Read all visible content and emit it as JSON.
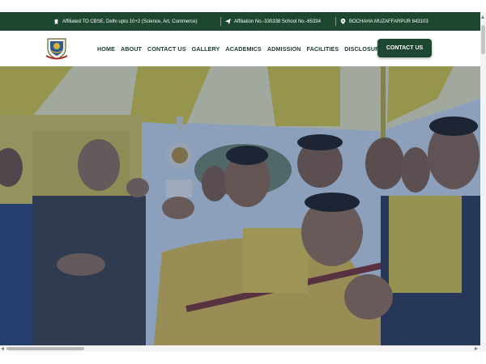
{
  "topbar": {
    "affiliation_text": "Affiliated TO CBSE, Delhi upto 10+2 (Science, Art, Commerce)",
    "affiliation_no_text": "Affiliation No.-330338 School No.-65334",
    "location_text": "BOCHAHA MUZAFFARPUR 843103"
  },
  "nav": {
    "items": [
      "HOME",
      "ABOUT",
      "CONTACT US",
      "GALLERY",
      "ACADEMICS",
      "ADMISSION",
      "FACILITIES",
      "DISCLOSURE"
    ],
    "contact_button": "CONTACT US"
  },
  "colors": {
    "brand_green": "#1d4730",
    "hero_overlay": "#1c3d6b",
    "tent_yellow": "#d9c13a"
  },
  "icons": {
    "affiliation": "badge-icon",
    "affiliation_no": "send-icon",
    "location": "map-pin-icon"
  }
}
